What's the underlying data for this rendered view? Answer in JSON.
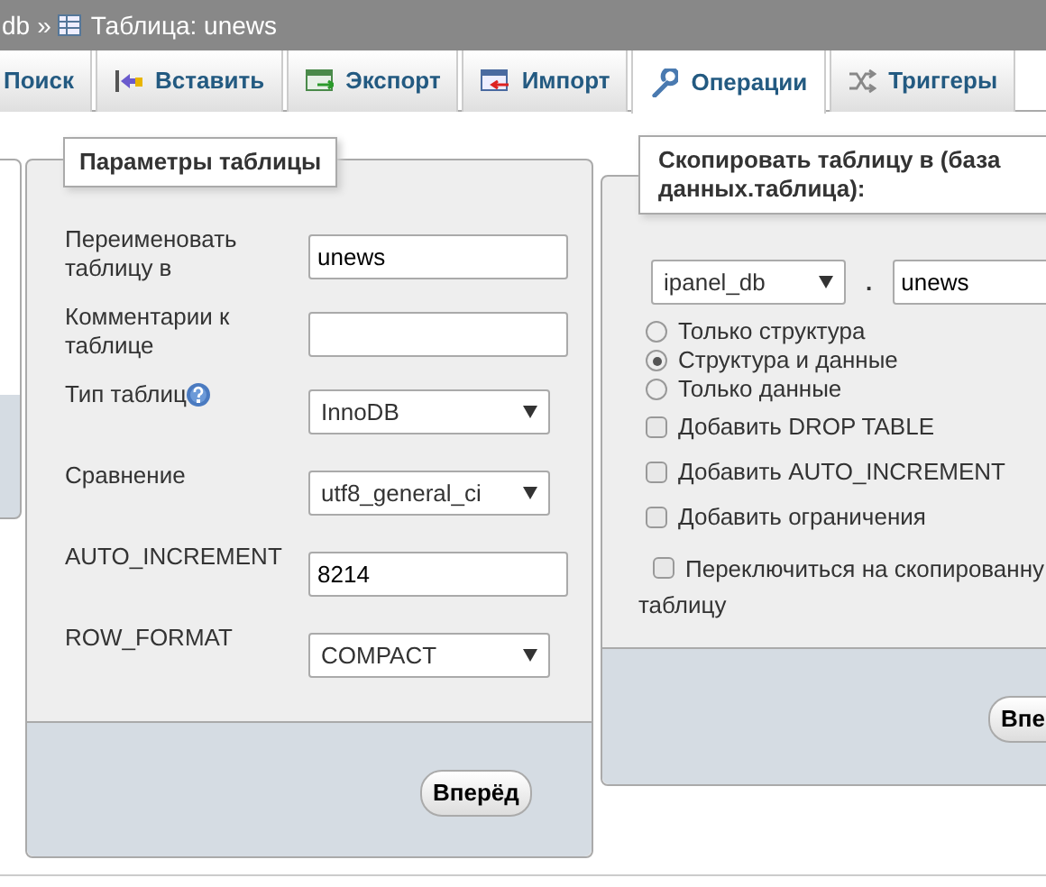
{
  "breadcrumb": {
    "database": "db",
    "separator": "»",
    "table": "Таблица: unews"
  },
  "tabs": [
    {
      "label": "Поиск",
      "selected": false
    },
    {
      "label": "Вставить",
      "selected": false
    },
    {
      "label": "Экспорт",
      "selected": false
    },
    {
      "label": "Импорт",
      "selected": false
    },
    {
      "label": "Операции",
      "selected": true
    },
    {
      "label": "Триггеры",
      "selected": false
    }
  ],
  "table_options": {
    "legend": "Параметры таблицы",
    "fields": [
      {
        "label": "Переименовать таблицу в",
        "kind": "text",
        "value": "unews"
      },
      {
        "label": "Комментарии к таблице",
        "kind": "text"
      },
      {
        "label": "Тип таблиц",
        "kind": "select",
        "help": true,
        "value": "InnoDB"
      },
      {
        "label": "Сравнение",
        "kind": "select",
        "value": "utf8_general_ci"
      },
      {
        "label": "AUTO_INCREMENT",
        "kind": "text",
        "value": "8214"
      },
      {
        "label": "ROW_FORMAT",
        "kind": "select",
        "value": "COMPACT"
      }
    ],
    "button": "Вперёд"
  },
  "copy_table": {
    "legend": "Скопировать таблицу в (база данных.таблица):",
    "database": "ipanel_db",
    "separator": ".",
    "table": "unews",
    "options": [
      {
        "kind": "radio",
        "label": "Только структура",
        "selected": false
      },
      {
        "kind": "radio",
        "label": "Структура и данные",
        "selected": true
      },
      {
        "kind": "radio",
        "label": "Только данные",
        "selected": false
      },
      {
        "kind": "checkbox",
        "label": "Добавить DROP TABLE",
        "checked": false
      },
      {
        "kind": "checkbox",
        "label": "Добавить AUTO_INCREMENT",
        "checked": false
      },
      {
        "kind": "checkbox",
        "label": "Добавить ограничения",
        "checked": false
      },
      {
        "kind": "checkbox",
        "label": "Переключиться на скопированну таблицу",
        "checked": false
      }
    ],
    "button": "Впе"
  }
}
